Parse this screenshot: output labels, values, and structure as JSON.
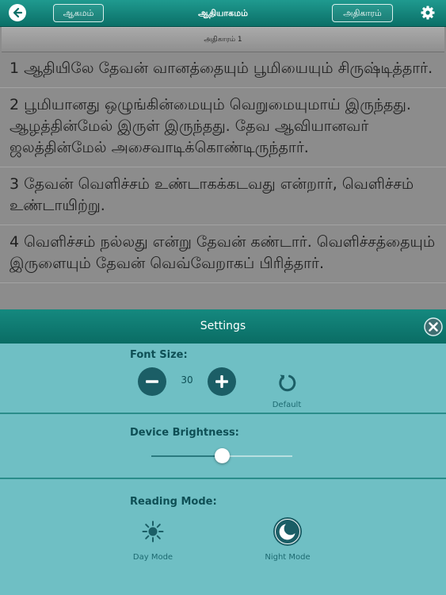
{
  "header": {
    "book_button": "ஆகமம்",
    "title": "ஆதியாகமம்",
    "chapter_button": "அதிகாரம்"
  },
  "chapter_label": "அதிகாரம் 1",
  "verses": [
    {
      "text": "1 ஆதியிலே தேவன் வானத்தையும் பூமியையும் சிருஷ்டித்தார்."
    },
    {
      "text": "2 பூமியானது ஒழுங்கின்மையும் வெறுமையுமாய் இருந்தது. ஆழத்தின்மேல் இருள் இருந்தது. தேவ ஆவியானவர் ஜலத்தின்மேல் அசைவாடிக்கொண்டிருந்தார்."
    },
    {
      "text": "3 தேவன் வெளிச்சம் உண்டாகக்கடவது என்றார், வெளிச்சம் உண்டாயிற்று."
    },
    {
      "text": "4 வெளிச்சம் நல்லது என்று தேவன் கண்டார். வெளிச்சத்தையும் இருளையும் தேவன் வெவ்வேறாகப் பிரித்தார்."
    }
  ],
  "settings": {
    "title": "Settings",
    "font_size_label": "Font Size:",
    "font_size_value": "30",
    "default_label": "Default",
    "brightness_label": "Device Brightness:",
    "brightness_level": 0.5,
    "reading_mode_label": "Reading Mode:",
    "day_mode_label": "Day Mode",
    "night_mode_label": "Night Mode"
  },
  "icons": {
    "back": "back-arrow-icon",
    "settings": "gear-icon",
    "close": "close-icon",
    "decrease": "minus-icon",
    "increase": "plus-icon",
    "reset": "reset-icon",
    "day": "sun-icon",
    "night": "moon-icon"
  },
  "colors": {
    "accent": "#0e7a72",
    "panel": "#6fbfc4",
    "verse_background": "#8c8c8c"
  }
}
